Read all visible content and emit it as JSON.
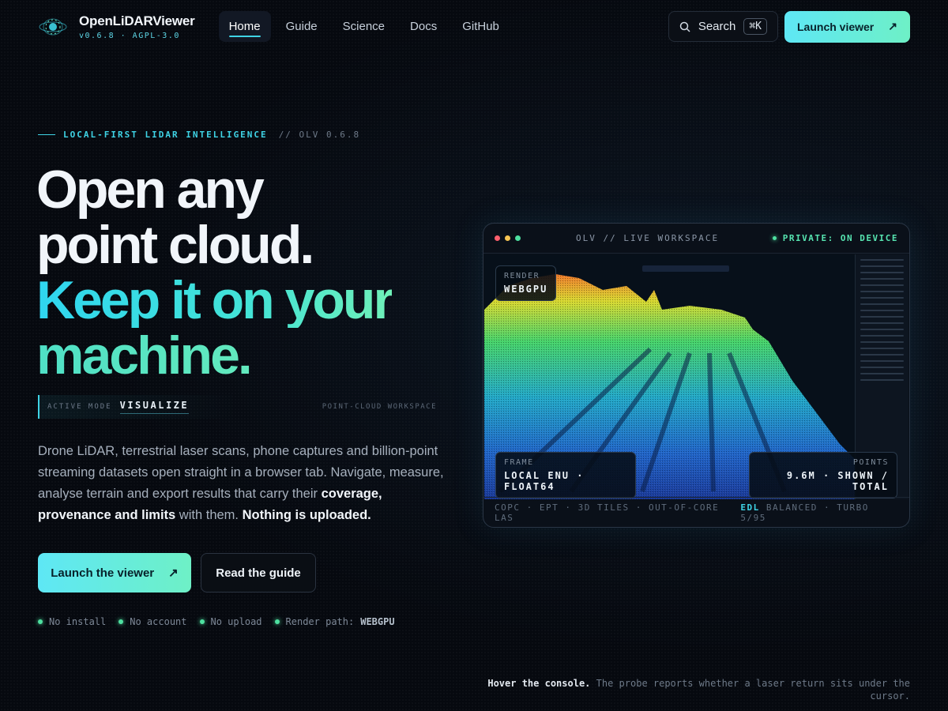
{
  "brand": {
    "name": "OpenLiDARViewer",
    "version": "v0.6.8 · AGPL-3.0",
    "logo_icon": "lidar-orbit-icon"
  },
  "nav": {
    "links": [
      {
        "label": "Home",
        "active": true
      },
      {
        "label": "Guide"
      },
      {
        "label": "Science"
      },
      {
        "label": "Docs"
      },
      {
        "label": "GitHub"
      }
    ],
    "search_label": "Search",
    "search_shortcut": "⌘K",
    "launch_label": "Launch viewer",
    "launch_icon": "arrow-up-right-icon"
  },
  "hero": {
    "eyebrow_tag": "LOCAL-FIRST LIDAR INTELLIGENCE",
    "eyebrow_version": "// OLV 0.6.8",
    "headline_line1": "Open any",
    "headline_line2": "point cloud.",
    "headline_line3": "Keep it on your",
    "headline_line4": "machine.",
    "mode_label": "ACTIVE MODE",
    "mode_value": "VISUALIZE",
    "mode_right": "POINT-CLOUD WORKSPACE",
    "description_part1": "Drone LiDAR, terrestrial laser scans, phone captures and billion-point streaming datasets open straight in a browser tab. Navigate, measure, analyse terrain and export results that carry their ",
    "description_bold1": "coverage, provenance and limits",
    "description_part2": " with them. ",
    "description_bold2": "Nothing is uploaded.",
    "cta_primary": "Launch the viewer",
    "cta_secondary": "Read the guide",
    "badges": [
      "No install",
      "No account",
      "No upload"
    ],
    "render_path_label": "Render path:",
    "render_path_value": "WEBGPU"
  },
  "console": {
    "title": "OLV // LIVE WORKSPACE",
    "private_label": "PRIVATE: ON DEVICE",
    "render_key": "RENDER",
    "render_value": "WEBGPU",
    "frame_key": "FRAME",
    "frame_value": "LOCAL ENU · FLOAT64",
    "points_key": "POINTS",
    "points_value": "9.6M · SHOWN / TOTAL",
    "formats": "COPC · EPT · 3D TILES · OUT-OF-CORE LAS",
    "edl_label": "EDL",
    "edl_rest": "BALANCED · TURBO 5/95",
    "colors": {
      "traffic_red": "#ff5f6d",
      "traffic_yellow": "#f6c453",
      "traffic_green": "#4ee0a0"
    }
  },
  "hover_note": {
    "bold": "Hover the console.",
    "rest": "The probe reports whether a laser return sits under the cursor."
  },
  "theme": {
    "accent": "#3fd4e6",
    "accent_green": "#6ef0c6",
    "background": "#06090f"
  }
}
